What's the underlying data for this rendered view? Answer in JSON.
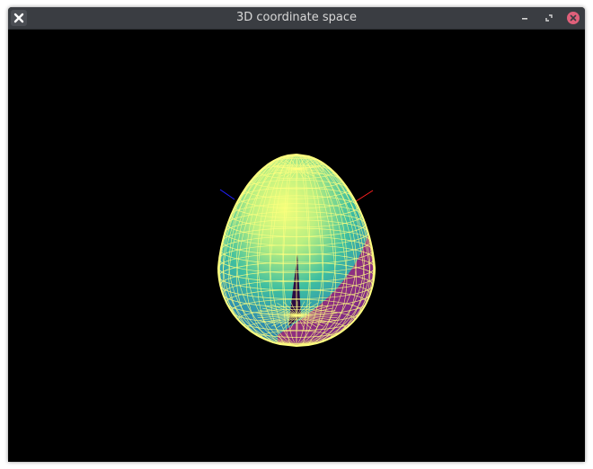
{
  "window": {
    "title": "3D coordinate space",
    "controls": {
      "minimize_icon": "minimize-icon",
      "maximize_icon": "maximize-icon",
      "close_icon": "close-icon"
    },
    "app_icon": "app-x-icon"
  },
  "scene": {
    "background": "#000000",
    "object": "egg-shaped wireframe mesh",
    "wire_color": "#ffff80",
    "surface_colors": [
      "#f0ff78",
      "#9fe58a",
      "#33b3a0",
      "#6fa1c8",
      "#7a2a9a",
      "#b0336c"
    ],
    "axes": {
      "x_color": "#ff2020",
      "y_color": "#2020ff"
    }
  },
  "colors": {
    "titlebar": "#3a3d42",
    "title_text": "#d7d7d7",
    "close_button": "#e0607a"
  }
}
